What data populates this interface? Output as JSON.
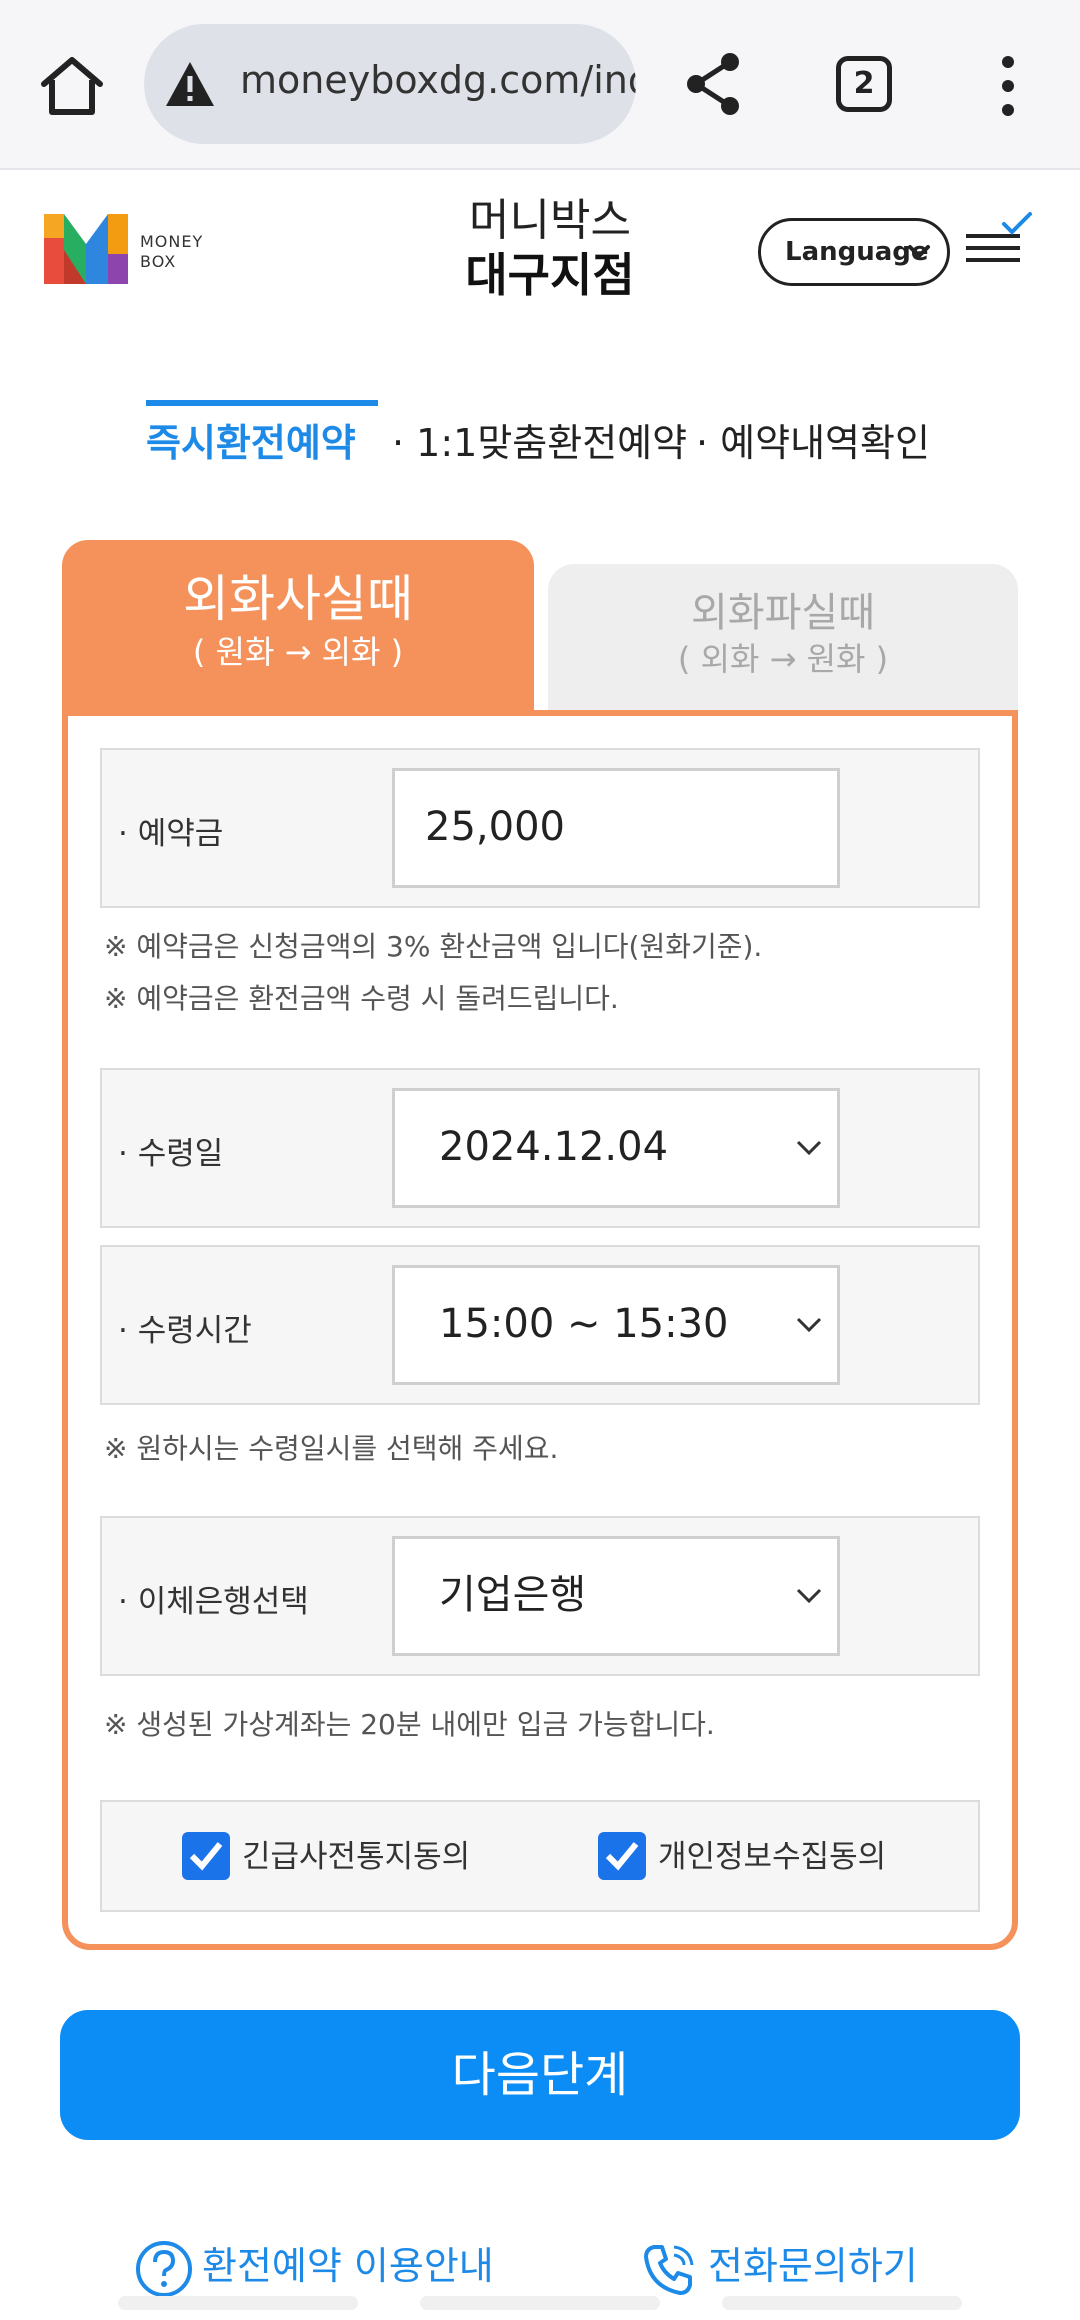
{
  "browser": {
    "url": "moneyboxdg.com/ind",
    "tab_count": "2",
    "icons": [
      "home-icon",
      "warning-icon",
      "share-icon",
      "more-vert-icon"
    ]
  },
  "header": {
    "logo_text_1": "MONEY",
    "logo_text_2": "BOX",
    "title_line1": "머니박스",
    "title_line2": "대구지점",
    "language_label": "Language"
  },
  "subnav": {
    "items": [
      {
        "label": "즉시환전예약",
        "active": true
      },
      {
        "label": "· 1:1맞춤환전예약",
        "active": false
      },
      {
        "label": "· 예약내역확인",
        "active": false
      }
    ]
  },
  "tabs": {
    "buy": {
      "label": "외화사실때",
      "sub": "( 원화 → 외화 )",
      "active": true
    },
    "sell": {
      "label": "외화파실때",
      "sub": "( 외화 → 원화 )",
      "active": false
    }
  },
  "form": {
    "deposit": {
      "label": "· 예약금",
      "value": "25,000"
    },
    "deposit_notes": [
      "※ 예약금은 신청금액의 3% 환산금액 입니다(원화기준).",
      "※ 예약금은 환전금액 수령 시 돌려드립니다."
    ],
    "pickup_date": {
      "label": "· 수령일",
      "value": "2024.12.04"
    },
    "pickup_time": {
      "label": "· 수령시간",
      "value": "15:00 ~ 15:30"
    },
    "pickup_note": "※ 원하시는 수령일시를 선택해 주세요.",
    "bank": {
      "label": "· 이체은행선택",
      "value": "기업은행"
    },
    "bank_note": "※  생성된 가상계좌는 20분 내에만 입금 가능합니다.",
    "agree_emergency": {
      "label": "긴급사전통지동의",
      "checked": true
    },
    "agree_privacy": {
      "label": "개인정보수집동의",
      "checked": true
    }
  },
  "next_button": "다음단계",
  "footer": {
    "guide_link": "환전예약 이용안내",
    "phone_link": "전화문의하기"
  },
  "colors": {
    "accent_orange": "#f5915a",
    "accent_blue": "#1e8ae8",
    "button_blue": "#0c8cf5",
    "checkbox_blue": "#1a73e8"
  }
}
